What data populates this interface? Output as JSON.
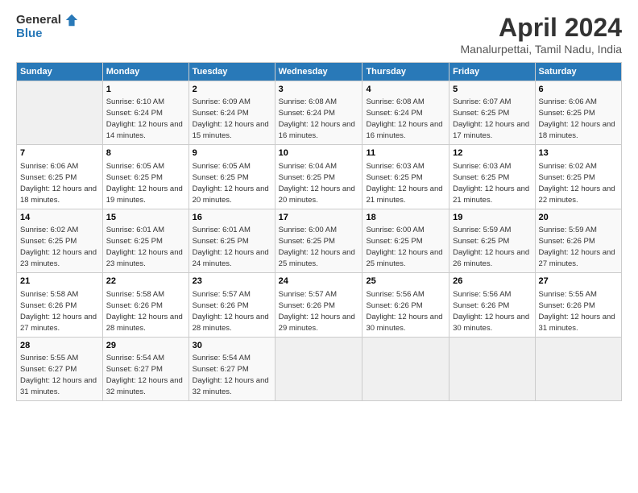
{
  "header": {
    "logo_line1": "General",
    "logo_line2": "Blue",
    "title": "April 2024",
    "subtitle": "Manalurpettai, Tamil Nadu, India"
  },
  "days_of_week": [
    "Sunday",
    "Monday",
    "Tuesday",
    "Wednesday",
    "Thursday",
    "Friday",
    "Saturday"
  ],
  "weeks": [
    [
      {
        "day": "",
        "sunrise": "",
        "sunset": "",
        "daylight": ""
      },
      {
        "day": "1",
        "sunrise": "Sunrise: 6:10 AM",
        "sunset": "Sunset: 6:24 PM",
        "daylight": "Daylight: 12 hours and 14 minutes."
      },
      {
        "day": "2",
        "sunrise": "Sunrise: 6:09 AM",
        "sunset": "Sunset: 6:24 PM",
        "daylight": "Daylight: 12 hours and 15 minutes."
      },
      {
        "day": "3",
        "sunrise": "Sunrise: 6:08 AM",
        "sunset": "Sunset: 6:24 PM",
        "daylight": "Daylight: 12 hours and 16 minutes."
      },
      {
        "day": "4",
        "sunrise": "Sunrise: 6:08 AM",
        "sunset": "Sunset: 6:24 PM",
        "daylight": "Daylight: 12 hours and 16 minutes."
      },
      {
        "day": "5",
        "sunrise": "Sunrise: 6:07 AM",
        "sunset": "Sunset: 6:25 PM",
        "daylight": "Daylight: 12 hours and 17 minutes."
      },
      {
        "day": "6",
        "sunrise": "Sunrise: 6:06 AM",
        "sunset": "Sunset: 6:25 PM",
        "daylight": "Daylight: 12 hours and 18 minutes."
      }
    ],
    [
      {
        "day": "7",
        "sunrise": "Sunrise: 6:06 AM",
        "sunset": "Sunset: 6:25 PM",
        "daylight": "Daylight: 12 hours and 18 minutes."
      },
      {
        "day": "8",
        "sunrise": "Sunrise: 6:05 AM",
        "sunset": "Sunset: 6:25 PM",
        "daylight": "Daylight: 12 hours and 19 minutes."
      },
      {
        "day": "9",
        "sunrise": "Sunrise: 6:05 AM",
        "sunset": "Sunset: 6:25 PM",
        "daylight": "Daylight: 12 hours and 20 minutes."
      },
      {
        "day": "10",
        "sunrise": "Sunrise: 6:04 AM",
        "sunset": "Sunset: 6:25 PM",
        "daylight": "Daylight: 12 hours and 20 minutes."
      },
      {
        "day": "11",
        "sunrise": "Sunrise: 6:03 AM",
        "sunset": "Sunset: 6:25 PM",
        "daylight": "Daylight: 12 hours and 21 minutes."
      },
      {
        "day": "12",
        "sunrise": "Sunrise: 6:03 AM",
        "sunset": "Sunset: 6:25 PM",
        "daylight": "Daylight: 12 hours and 21 minutes."
      },
      {
        "day": "13",
        "sunrise": "Sunrise: 6:02 AM",
        "sunset": "Sunset: 6:25 PM",
        "daylight": "Daylight: 12 hours and 22 minutes."
      }
    ],
    [
      {
        "day": "14",
        "sunrise": "Sunrise: 6:02 AM",
        "sunset": "Sunset: 6:25 PM",
        "daylight": "Daylight: 12 hours and 23 minutes."
      },
      {
        "day": "15",
        "sunrise": "Sunrise: 6:01 AM",
        "sunset": "Sunset: 6:25 PM",
        "daylight": "Daylight: 12 hours and 23 minutes."
      },
      {
        "day": "16",
        "sunrise": "Sunrise: 6:01 AM",
        "sunset": "Sunset: 6:25 PM",
        "daylight": "Daylight: 12 hours and 24 minutes."
      },
      {
        "day": "17",
        "sunrise": "Sunrise: 6:00 AM",
        "sunset": "Sunset: 6:25 PM",
        "daylight": "Daylight: 12 hours and 25 minutes."
      },
      {
        "day": "18",
        "sunrise": "Sunrise: 6:00 AM",
        "sunset": "Sunset: 6:25 PM",
        "daylight": "Daylight: 12 hours and 25 minutes."
      },
      {
        "day": "19",
        "sunrise": "Sunrise: 5:59 AM",
        "sunset": "Sunset: 6:25 PM",
        "daylight": "Daylight: 12 hours and 26 minutes."
      },
      {
        "day": "20",
        "sunrise": "Sunrise: 5:59 AM",
        "sunset": "Sunset: 6:26 PM",
        "daylight": "Daylight: 12 hours and 27 minutes."
      }
    ],
    [
      {
        "day": "21",
        "sunrise": "Sunrise: 5:58 AM",
        "sunset": "Sunset: 6:26 PM",
        "daylight": "Daylight: 12 hours and 27 minutes."
      },
      {
        "day": "22",
        "sunrise": "Sunrise: 5:58 AM",
        "sunset": "Sunset: 6:26 PM",
        "daylight": "Daylight: 12 hours and 28 minutes."
      },
      {
        "day": "23",
        "sunrise": "Sunrise: 5:57 AM",
        "sunset": "Sunset: 6:26 PM",
        "daylight": "Daylight: 12 hours and 28 minutes."
      },
      {
        "day": "24",
        "sunrise": "Sunrise: 5:57 AM",
        "sunset": "Sunset: 6:26 PM",
        "daylight": "Daylight: 12 hours and 29 minutes."
      },
      {
        "day": "25",
        "sunrise": "Sunrise: 5:56 AM",
        "sunset": "Sunset: 6:26 PM",
        "daylight": "Daylight: 12 hours and 30 minutes."
      },
      {
        "day": "26",
        "sunrise": "Sunrise: 5:56 AM",
        "sunset": "Sunset: 6:26 PM",
        "daylight": "Daylight: 12 hours and 30 minutes."
      },
      {
        "day": "27",
        "sunrise": "Sunrise: 5:55 AM",
        "sunset": "Sunset: 6:26 PM",
        "daylight": "Daylight: 12 hours and 31 minutes."
      }
    ],
    [
      {
        "day": "28",
        "sunrise": "Sunrise: 5:55 AM",
        "sunset": "Sunset: 6:27 PM",
        "daylight": "Daylight: 12 hours and 31 minutes."
      },
      {
        "day": "29",
        "sunrise": "Sunrise: 5:54 AM",
        "sunset": "Sunset: 6:27 PM",
        "daylight": "Daylight: 12 hours and 32 minutes."
      },
      {
        "day": "30",
        "sunrise": "Sunrise: 5:54 AM",
        "sunset": "Sunset: 6:27 PM",
        "daylight": "Daylight: 12 hours and 32 minutes."
      },
      {
        "day": "",
        "sunrise": "",
        "sunset": "",
        "daylight": ""
      },
      {
        "day": "",
        "sunrise": "",
        "sunset": "",
        "daylight": ""
      },
      {
        "day": "",
        "sunrise": "",
        "sunset": "",
        "daylight": ""
      },
      {
        "day": "",
        "sunrise": "",
        "sunset": "",
        "daylight": ""
      }
    ]
  ]
}
